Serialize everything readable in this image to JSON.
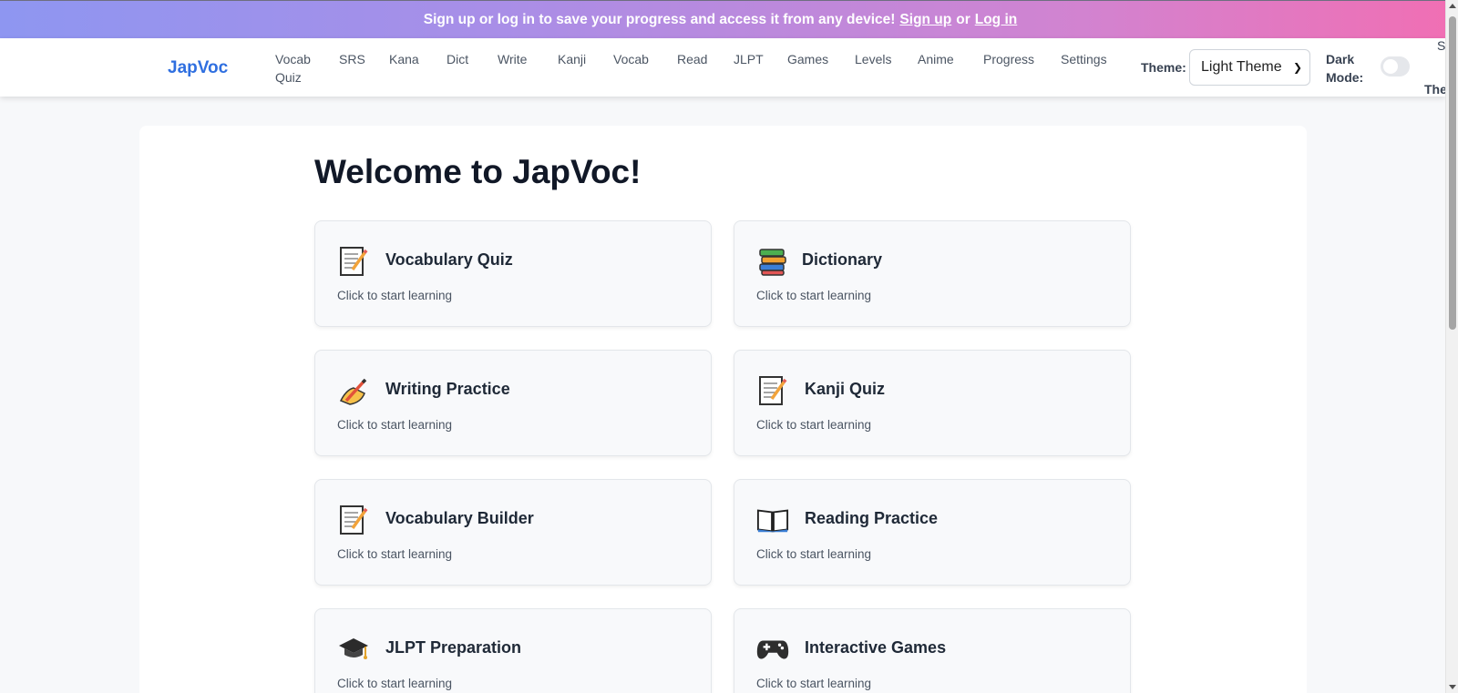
{
  "banner": {
    "text": "Sign up or log in to save your progress and access it from any device!",
    "signup_label": "Sign up",
    "or": "or",
    "login_label": "Log in"
  },
  "nav": {
    "logo": "JapVoc",
    "links": [
      "Vocab Quiz",
      "SRS",
      "Kana",
      "Dict",
      "Write",
      "Kanji",
      "Vocab",
      "Read",
      "JLPT",
      "Games",
      "Levels",
      "Anime",
      "Progress",
      "Settings"
    ],
    "theme_label": "Theme:",
    "theme_value": "Light Theme",
    "dark_mode_label": "Dark Mode:",
    "dark_mode_on": false,
    "clipped_right_top": "S",
    "clipped_right_bottom": "The"
  },
  "main": {
    "welcome": "Welcome to JapVoc!",
    "cards": [
      {
        "title": "Vocabulary Quiz",
        "subtitle": "Click to start learning",
        "icon": "memo-icon"
      },
      {
        "title": "Dictionary",
        "subtitle": "Click to start learning",
        "icon": "books-icon"
      },
      {
        "title": "Writing Practice",
        "subtitle": "Click to start learning",
        "icon": "writing-hand-icon"
      },
      {
        "title": "Kanji Quiz",
        "subtitle": "Click to start learning",
        "icon": "memo-icon"
      },
      {
        "title": "Vocabulary Builder",
        "subtitle": "Click to start learning",
        "icon": "memo-icon"
      },
      {
        "title": "Reading Practice",
        "subtitle": "Click to start learning",
        "icon": "open-book-icon"
      },
      {
        "title": "JLPT Preparation",
        "subtitle": "Click to start learning",
        "icon": "graduation-cap-icon"
      },
      {
        "title": "Interactive Games",
        "subtitle": "Click to start learning",
        "icon": "gamepad-icon"
      }
    ]
  },
  "colors": {
    "accent": "#2f6fe0",
    "banner_start": "#8e96f1",
    "banner_end": "#f06fb4"
  }
}
